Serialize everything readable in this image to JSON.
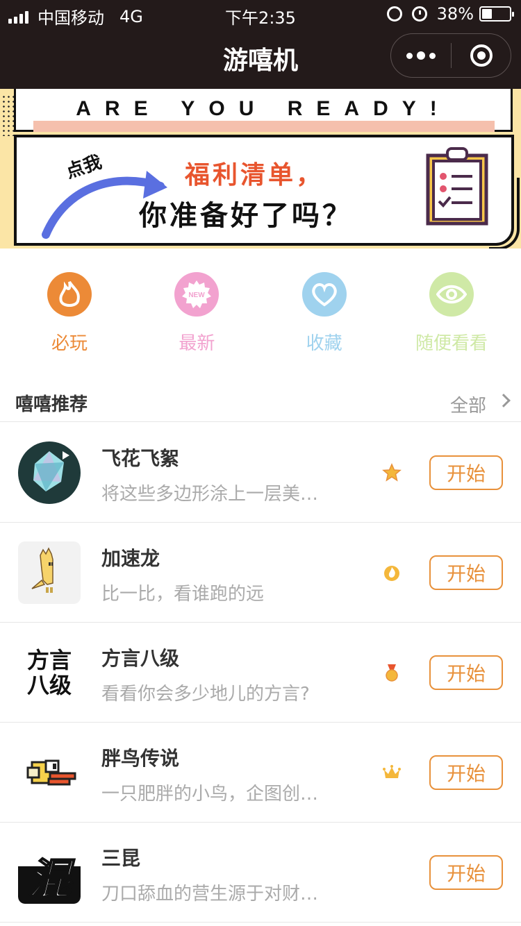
{
  "status_bar": {
    "carrier": "中国移动",
    "network": "4G",
    "time": "下午2:35",
    "battery_pct": "38%",
    "battery_level": 0.38
  },
  "nav": {
    "title": "游嘻机"
  },
  "banner": {
    "headline": "ARE YOU READY!",
    "click_me": "点我",
    "welfare": "福利清单，",
    "question": "你准备好了吗？"
  },
  "categories": [
    {
      "label": "必玩",
      "icon": "fire-icon",
      "color": "#ec8a37"
    },
    {
      "label": "最新",
      "icon": "new-badge-icon",
      "color": "#f2a2cf"
    },
    {
      "label": "收藏",
      "icon": "heart-icon",
      "color": "#9fd2ee"
    },
    {
      "label": "随便看看",
      "icon": "eye-icon",
      "color": "#cfe9a6"
    }
  ],
  "section": {
    "title": "嘻嘻推荐",
    "all": "全部"
  },
  "games": [
    {
      "name": "飞花飞絮",
      "desc": "将这些多边形涂上一层美…",
      "badge": "star-badge-icon",
      "button": "开始"
    },
    {
      "name": "加速龙",
      "desc": "比一比，看谁跑的远",
      "badge": "flame-badge-icon",
      "button": "开始"
    },
    {
      "name": "方言八级",
      "desc": "看看你会多少地儿的方言?",
      "badge": "medal-badge-icon",
      "button": "开始",
      "thumb_text": "方言八级"
    },
    {
      "name": "胖鸟传说",
      "desc": "一只肥胖的小鸟，企图创…",
      "badge": "crown-badge-icon",
      "button": "开始"
    },
    {
      "name": "三昆",
      "desc": "刀口舔血的营生源于对财…",
      "badge": "",
      "button": "开始",
      "thumb_text": "混"
    }
  ],
  "colors": {
    "accent": "#e8913b",
    "nav_bg": "#231a1a",
    "banner_bg": "#fbe5a6",
    "welfare_red": "#e8552e"
  }
}
